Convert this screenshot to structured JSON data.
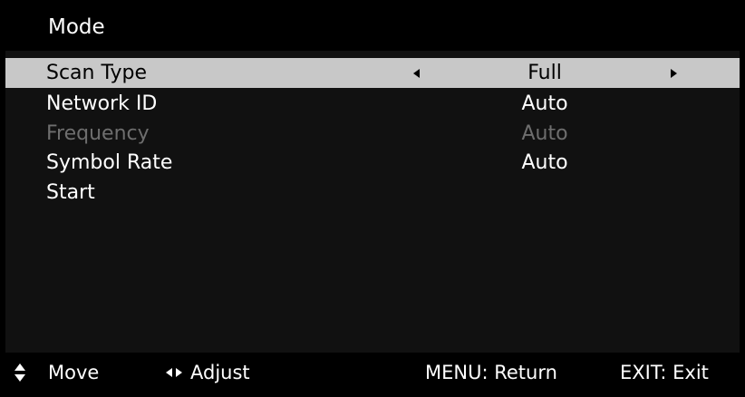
{
  "menu": {
    "title": "Mode",
    "rows": [
      {
        "label": "Scan Type",
        "value": "Full",
        "selected": true,
        "disabled": false,
        "has_arrows": true
      },
      {
        "label": "Network ID",
        "value": "Auto",
        "selected": false,
        "disabled": false,
        "has_arrows": false
      },
      {
        "label": "Frequency",
        "value": "Auto",
        "selected": false,
        "disabled": true,
        "has_arrows": false
      },
      {
        "label": "Symbol Rate",
        "value": "Auto",
        "selected": false,
        "disabled": false,
        "has_arrows": false
      },
      {
        "label": "Start",
        "value": "",
        "selected": false,
        "disabled": false,
        "has_arrows": false
      }
    ]
  },
  "footer": {
    "move_label": "Move",
    "adjust_label": "Adjust",
    "return_label": "MENU: Return",
    "exit_label": "EXIT: Exit",
    "move_icon": "up-down-arrows-icon",
    "adjust_icon": "left-right-arrows-icon"
  },
  "colors": {
    "background": "#111111",
    "bars": "#000000",
    "selected_row": "#c8c8c8",
    "selected_text": "#000000",
    "normal_text": "#ffffff",
    "disabled_text": "#6e6e6e"
  }
}
